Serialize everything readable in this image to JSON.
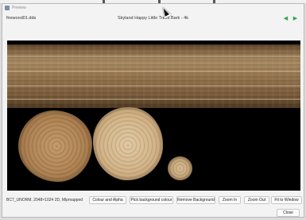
{
  "window": {
    "title": "Preview"
  },
  "header": {
    "file_name": "firewood01.dds",
    "title": "Skyland Happy Little Trees Bark - 4k"
  },
  "toolbar": {
    "format_label": "BC7_UNORM, 2048×1024 2D, Mipmapped",
    "buttons": [
      "Colour and Alpha",
      "Pick background colour",
      "Remove Background",
      "Zoom In",
      "Zoom Out",
      "Fit to Window"
    ],
    "close_label": "Close"
  },
  "icons": {
    "back": "arrow-left-icon",
    "forward": "arrow-right-icon"
  },
  "colors": {
    "nav_arrow": "#2fa84f",
    "viewport_background": "#000000"
  }
}
